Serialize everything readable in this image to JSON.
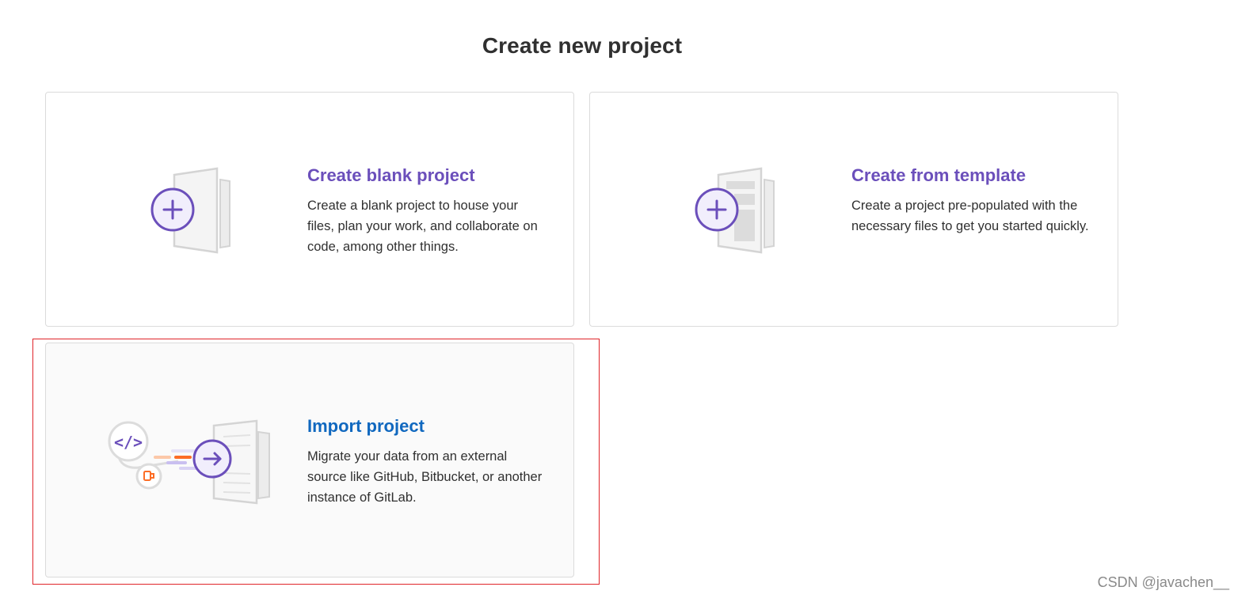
{
  "page": {
    "title": "Create new project"
  },
  "cards": {
    "blank": {
      "heading": "Create blank project",
      "description": "Create a blank project to house your files, plan your work, and collaborate on code, among other things.",
      "icon": "blank-project-illustration"
    },
    "template": {
      "heading": "Create from template",
      "description": "Create a project pre-populated with the necessary files to get you started quickly.",
      "icon": "template-project-illustration"
    },
    "import": {
      "heading": "Import project",
      "description": "Migrate your data from an external source like GitHub, Bitbucket, or another instance of GitLab.",
      "icon": "import-project-illustration"
    }
  },
  "watermark": "CSDN @javachen__",
  "colors": {
    "heading_purple": "#6b4fbb",
    "heading_blue": "#1068bf",
    "highlight_red": "#e0242a",
    "border": "#dbdbdb"
  }
}
